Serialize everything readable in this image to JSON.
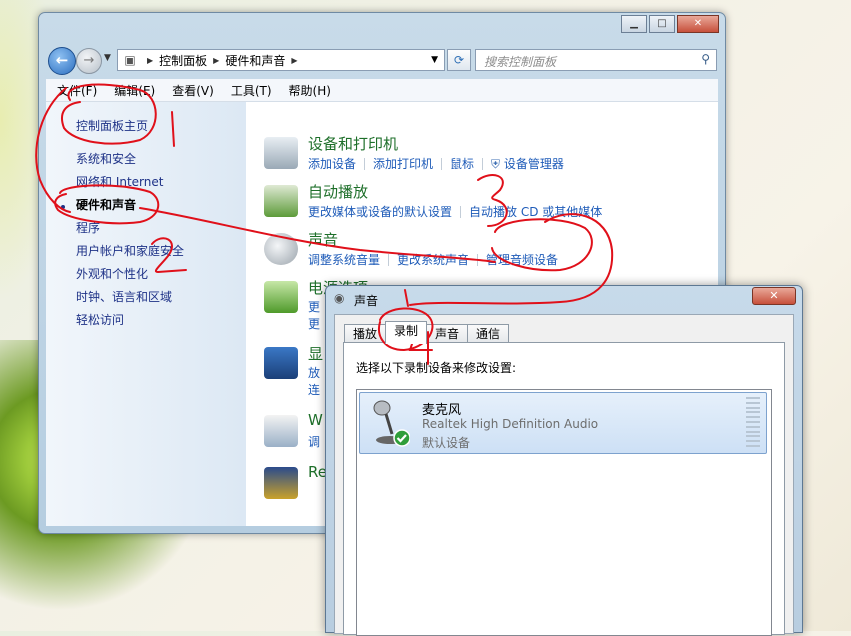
{
  "control_panel": {
    "address": [
      "控制面板",
      "硬件和声音"
    ],
    "search_placeholder": "搜索控制面板",
    "menu": [
      "文件(F)",
      "编辑(E)",
      "查看(V)",
      "工具(T)",
      "帮助(H)"
    ],
    "sidebar": {
      "home": "控制面板主页",
      "items": [
        "系统和安全",
        "网络和 Internet",
        "硬件和声音",
        "程序",
        "用户帐户和家庭安全",
        "外观和个性化",
        "时钟、语言和区域",
        "轻松访问"
      ]
    },
    "categories": [
      {
        "title": "设备和打印机",
        "links": [
          "添加设备",
          "添加打印机",
          "鼠标",
          "设备管理器"
        ]
      },
      {
        "title": "自动播放",
        "links": [
          "更改媒体或设备的默认设置",
          "自动播放 CD 或其他媒体"
        ]
      },
      {
        "title": "声音",
        "links": [
          "调整系统音量",
          "更改系统声音",
          "管理音频设备"
        ]
      },
      {
        "title": "电源选项",
        "links": [
          "更",
          "更"
        ]
      },
      {
        "title": "显",
        "links": [
          "放",
          "连"
        ]
      },
      {
        "title": "W",
        "links": [
          "调"
        ]
      },
      {
        "title": "Re",
        "links": []
      }
    ]
  },
  "sound_dialog": {
    "title": "声音",
    "close": "✕",
    "tabs": [
      "播放",
      "录制",
      "声音",
      "通信"
    ],
    "active_tab": "录制",
    "instruction": "选择以下录制设备来修改设置:",
    "device": {
      "name": "麦克风",
      "description": "Realtek High Definition Audio",
      "status": "默认设备"
    }
  },
  "annotations": [
    "1",
    "2",
    "3",
    "4"
  ],
  "colors": {
    "annotation": "#e0101a",
    "link": "#1e5bb8",
    "category_title": "#1e6f2a"
  }
}
